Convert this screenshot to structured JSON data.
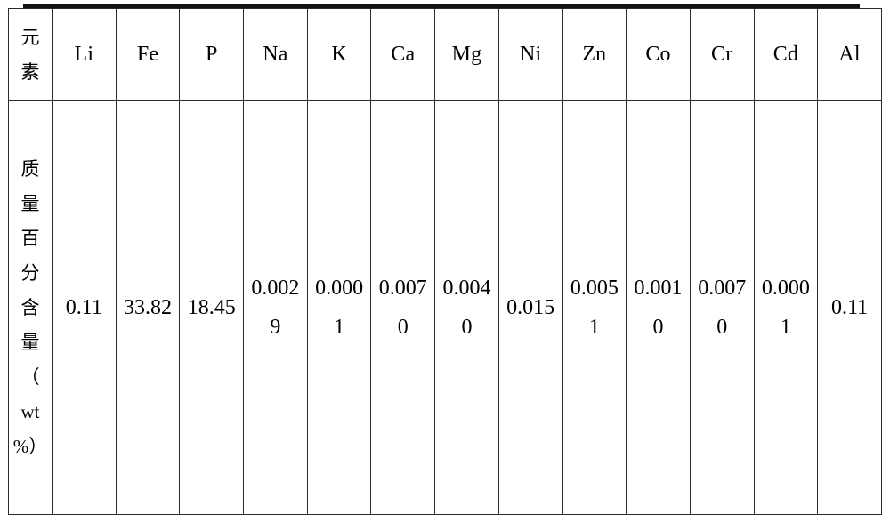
{
  "table": {
    "row_header_label_chars": [
      "元",
      "素"
    ],
    "row_data_label_chars": [
      "质",
      "量",
      "百",
      "分",
      "含",
      "量",
      "（",
      "wt",
      "%）"
    ],
    "row_data_label_text": "质量百分含量（wt%）",
    "columns": [
      {
        "element": "Li",
        "value": "0.11"
      },
      {
        "element": "Fe",
        "value": "33.82"
      },
      {
        "element": "P",
        "value": "18.45"
      },
      {
        "element": "Na",
        "value": "0.0029"
      },
      {
        "element": "K",
        "value": "0.0001"
      },
      {
        "element": "Ca",
        "value": "0.0070"
      },
      {
        "element": "Mg",
        "value": "0.0040"
      },
      {
        "element": "Ni",
        "value": "0.015"
      },
      {
        "element": "Zn",
        "value": "0.0051"
      },
      {
        "element": "Co",
        "value": "0.0010"
      },
      {
        "element": "Cr",
        "value": "0.0070"
      },
      {
        "element": "Cd",
        "value": "0.0001"
      },
      {
        "element": "Al",
        "value": "0.11"
      }
    ]
  },
  "colors": {
    "background": "#ffffff",
    "border": "#2b2b2b",
    "top_rule": "#111111",
    "text": "#000000"
  }
}
